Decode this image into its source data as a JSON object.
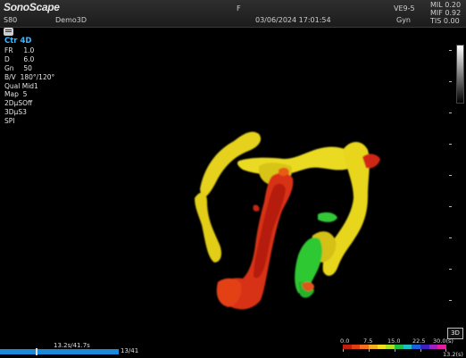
{
  "header": {
    "brand": "SonoScape",
    "device": "S80",
    "preset": "Demo3D",
    "orientation_marker": "F",
    "datetime": "03/06/2024 17:01:54",
    "probe": "VE9-5",
    "exam": "Gyn",
    "mil": "MIL 0.20",
    "mif": "MIF 0.92",
    "tis": "TIS 0.00"
  },
  "params": {
    "mode": "Ctr 4D",
    "rows": [
      {
        "k": "FR",
        "v": "1.0"
      },
      {
        "k": "D",
        "v": "6.0"
      },
      {
        "k": "Gn",
        "v": "50"
      },
      {
        "k": "B/V",
        "v": "180°/120°"
      },
      {
        "k": "Qual",
        "v": "Mid1"
      },
      {
        "k": "Map",
        "v": "5"
      },
      {
        "k": "2DμS",
        "v": "Off"
      },
      {
        "k": "3DμS",
        "v": "3"
      },
      {
        "k": "SPI",
        "v": ""
      }
    ]
  },
  "cine": {
    "time": "13.2s/41.7s",
    "frame": "13/41",
    "progress": 0.3
  },
  "velocity_scale": {
    "labels": [
      "0.0",
      "7.5",
      "15.0",
      "22.5",
      "30.0(s)"
    ],
    "bottom": "13.2(s)",
    "colors": [
      "#c02010",
      "#e04010",
      "#f07020",
      "#f0b020",
      "#f0e020",
      "#b0e020",
      "#20c040",
      "#20c0c0",
      "#2060e0",
      "#4020c0",
      "#a020c0",
      "#e020a0"
    ]
  },
  "buttons": {
    "view3d": "3D"
  },
  "icons": {
    "menu": "menu-icon"
  }
}
